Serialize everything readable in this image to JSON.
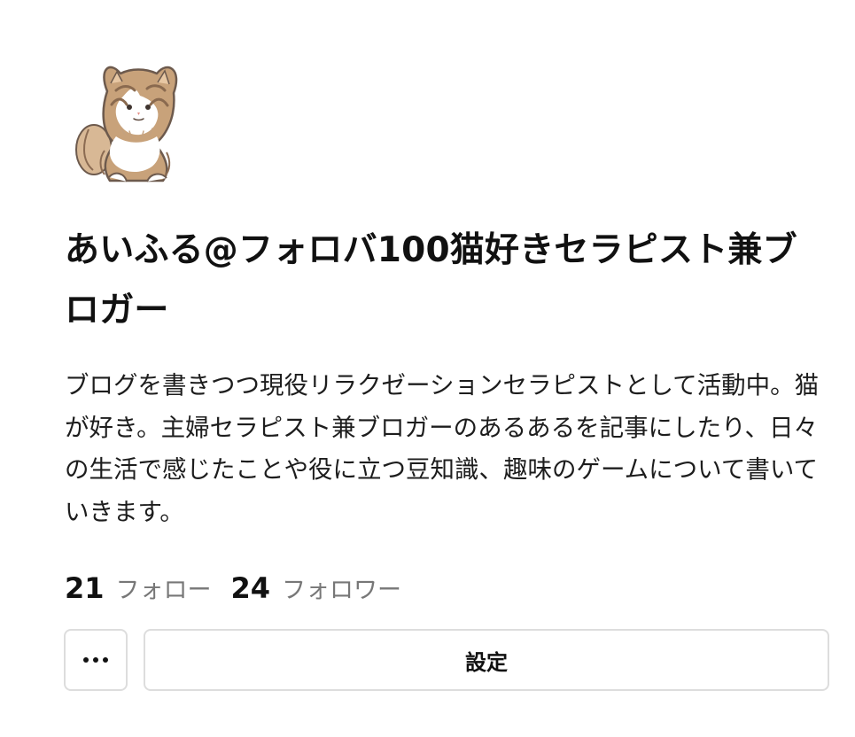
{
  "profile": {
    "avatar_icon": "cat-avatar-icon",
    "name": "あいふる@フォロバ100猫好きセラピスト兼ブロガー",
    "bio": "ブログを書きつつ現役リラクゼーションセラピストとして活動中。猫が好き。主婦セラピスト兼ブロガーのあるあるを記事にしたり、日々の生活で感じたことや役に立つ豆知識、趣味のゲームについて書いていきます。",
    "following_count": "21",
    "following_label": "フォロー",
    "followers_count": "24",
    "followers_label": "フォロワー"
  },
  "actions": {
    "more_icon": "more-horizontal-icon",
    "settings_label": "設定"
  },
  "colors": {
    "background": "#ffffff",
    "text": "#111111",
    "muted_text": "#777777",
    "button_border": "#dddddd",
    "cat_fur": "#c8a27a",
    "cat_white": "#ffffff"
  }
}
